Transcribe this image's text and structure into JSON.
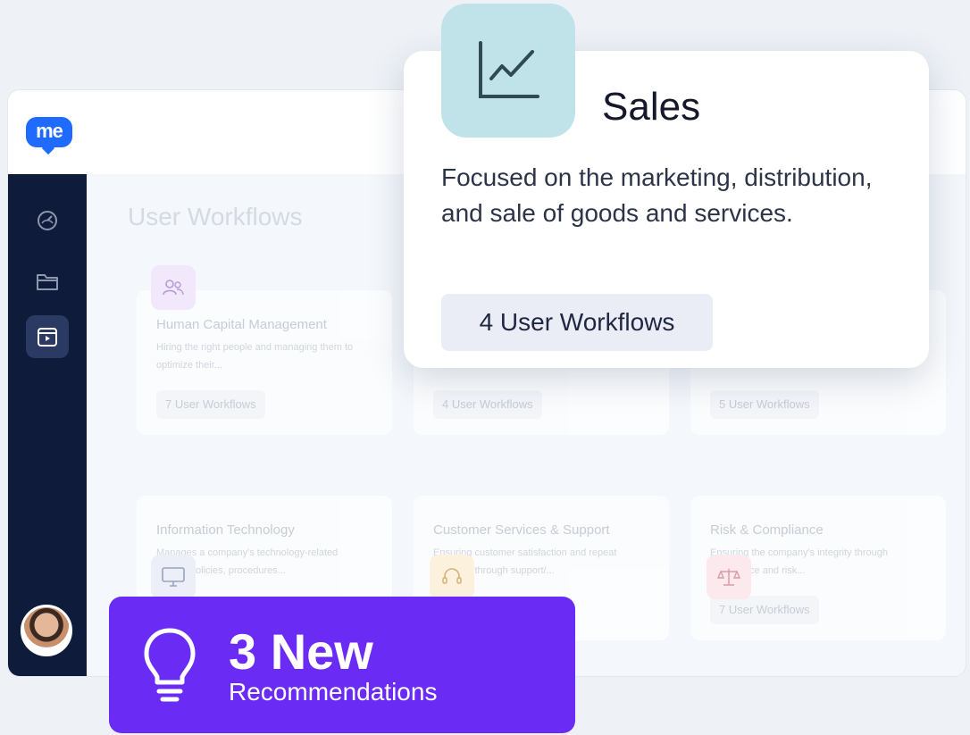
{
  "app": {
    "logo_text": "me",
    "main_title": "User Workflows",
    "sidebar": {
      "items": [
        {
          "icon": "dashboard-icon"
        },
        {
          "icon": "folder-icon"
        },
        {
          "icon": "workflow-icon",
          "active": true
        }
      ]
    },
    "cards": [
      {
        "title": "Human Capital Management",
        "desc": "Hiring the right people and managing them to optimize their...",
        "badge": "7 User Workflows",
        "icon": "users-icon",
        "icon_color": "#f1e8fb"
      },
      {
        "title": "",
        "desc": "",
        "badge": "4 User Workflows"
      },
      {
        "title": "",
        "desc": "",
        "badge": "5 User Workflows"
      },
      {
        "title": "Information Technology",
        "desc": "Manages a company's technology-related assets, policies, procedures...",
        "badge": "",
        "icon": "monitor-icon",
        "icon_color": "#eceef8"
      },
      {
        "title": "Customer Services & Support",
        "desc": "Ensuring customer satisfaction and repeat business through support/...",
        "badge": "",
        "icon": "headset-icon",
        "icon_color": "#fbf1dc"
      },
      {
        "title": "Risk & Compliance",
        "desc": "Ensuring the company's integrity through compliance and risk...",
        "badge": "7 User Workflows",
        "icon": "scale-icon",
        "icon_color": "#fbe9ee"
      }
    ]
  },
  "sales_popup": {
    "title": "Sales",
    "description": "Focused on the marketing, distribution, and sale of goods and services.",
    "badge": "4 User Workflows",
    "icon": "line-chart-icon",
    "icon_bg": "#bfe3e8"
  },
  "recommendations": {
    "count_text": "3 New",
    "label": "Recommendations",
    "icon": "lightbulb-icon",
    "bg_color": "#6a2cf5"
  }
}
